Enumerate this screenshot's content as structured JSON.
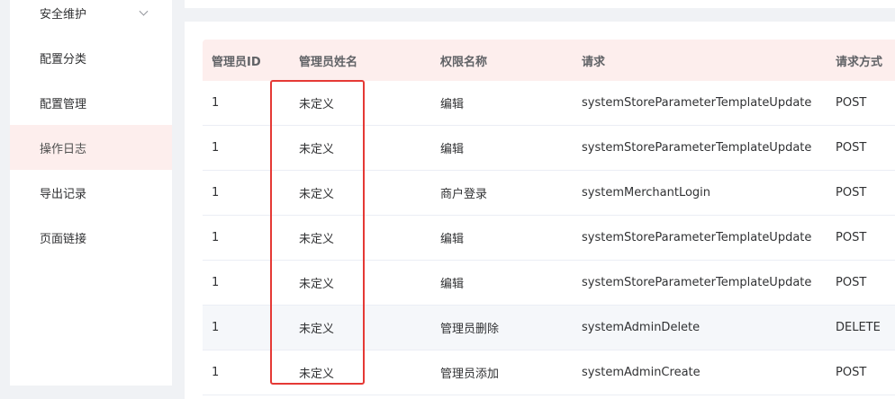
{
  "sidebar": {
    "items": [
      {
        "label": "安全维护",
        "has_chevron": true,
        "active": false
      },
      {
        "label": "配置分类",
        "active": false
      },
      {
        "label": "配置管理",
        "active": false
      },
      {
        "label": "操作日志",
        "active": true
      },
      {
        "label": "导出记录",
        "active": false
      },
      {
        "label": "页面链接",
        "active": false
      }
    ]
  },
  "table": {
    "headers": [
      "管理员ID",
      "管理员姓名",
      "权限名称",
      "请求",
      "请求方式"
    ],
    "rows": [
      [
        "1",
        "未定义",
        "编辑",
        "systemStoreParameterTemplateUpdate",
        "POST"
      ],
      [
        "1",
        "未定义",
        "编辑",
        "systemStoreParameterTemplateUpdate",
        "POST"
      ],
      [
        "1",
        "未定义",
        "商户登录",
        "systemMerchantLogin",
        "POST"
      ],
      [
        "1",
        "未定义",
        "编辑",
        "systemStoreParameterTemplateUpdate",
        "POST"
      ],
      [
        "1",
        "未定义",
        "编辑",
        "systemStoreParameterTemplateUpdate",
        "POST"
      ],
      [
        "1",
        "未定义",
        "管理员删除",
        "systemAdminDelete",
        "DELETE"
      ],
      [
        "1",
        "未定义",
        "管理员添加",
        "systemAdminCreate",
        "POST"
      ]
    ]
  },
  "colors": {
    "active_menu_bg": "#fdeeed",
    "header_bg": "#fdeeed",
    "highlight_border": "#e53935"
  }
}
